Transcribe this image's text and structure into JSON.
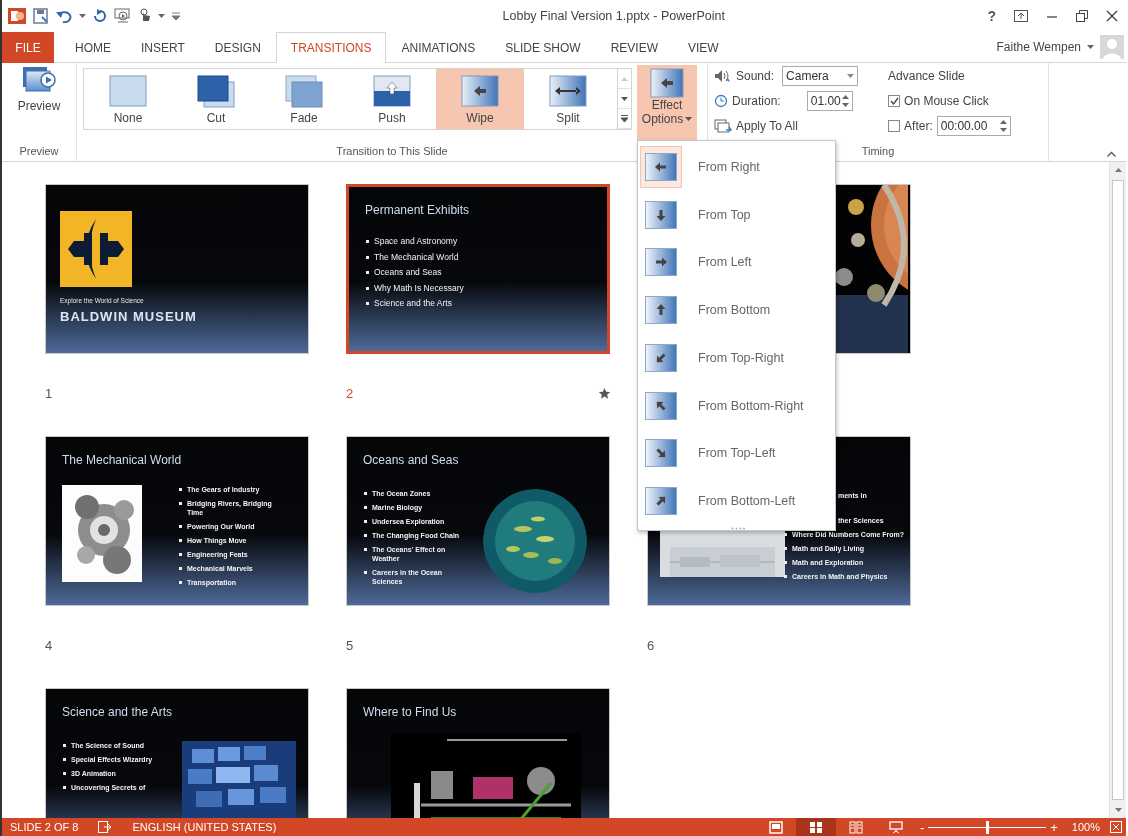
{
  "window": {
    "title": "Lobby Final Version 1.pptx - PowerPoint",
    "help": "?"
  },
  "tabs": [
    {
      "label": "FILE",
      "kind": "file",
      "selected": false
    },
    {
      "label": "HOME",
      "kind": "tab",
      "selected": false
    },
    {
      "label": "INSERT",
      "kind": "tab",
      "selected": false
    },
    {
      "label": "DESIGN",
      "kind": "tab",
      "selected": false
    },
    {
      "label": "TRANSITIONS",
      "kind": "tab",
      "selected": true
    },
    {
      "label": "ANIMATIONS",
      "kind": "tab",
      "selected": false
    },
    {
      "label": "SLIDE SHOW",
      "kind": "tab",
      "selected": false
    },
    {
      "label": "REVIEW",
      "kind": "tab",
      "selected": false
    },
    {
      "label": "VIEW",
      "kind": "tab",
      "selected": false
    }
  ],
  "user": {
    "name": "Faithe Wempen"
  },
  "ribbon": {
    "preview": {
      "button": "Preview",
      "group": "Preview"
    },
    "gallery": {
      "group": "Transition to This Slide",
      "items": [
        {
          "label": "None",
          "kind": "none",
          "selected": false
        },
        {
          "label": "Cut",
          "kind": "cut",
          "selected": false
        },
        {
          "label": "Fade",
          "kind": "fade",
          "selected": false
        },
        {
          "label": "Push",
          "kind": "push",
          "selected": false
        },
        {
          "label": "Wipe",
          "kind": "wipe",
          "selected": true
        },
        {
          "label": "Split",
          "kind": "split",
          "selected": false
        }
      ]
    },
    "effect_options": {
      "line1": "Effect",
      "line2": "Options",
      "expanded": true
    },
    "timing": {
      "group": "Timing",
      "sound": {
        "label": "Sound:",
        "value": "Camera"
      },
      "duration": {
        "label": "Duration:",
        "value": "01.00"
      },
      "apply_all": "Apply To All",
      "advance": {
        "title": "Advance Slide",
        "on_mouse_click": {
          "label": "On Mouse Click",
          "checked": true
        },
        "after": {
          "label": "After:",
          "checked": false,
          "value": "00:00.00"
        }
      }
    }
  },
  "slides": [
    {
      "kind": "title",
      "number": "1",
      "selected": false,
      "transition": false,
      "tagline": "Explore the World of Science",
      "title": "BALDWIN MUSEUM"
    },
    {
      "kind": "bullets",
      "number": "2",
      "selected": true,
      "transition": true,
      "title": "Permanent Exhibits",
      "bullets": [
        "Space and Astronomy",
        "The Mechanical World",
        "Oceans and Seas",
        "Why Math Is Necessary",
        "Science and the Arts"
      ]
    },
    {
      "kind": "picture"
    },
    {
      "kind": "picture-left",
      "number": "4",
      "selected": false,
      "transition": false,
      "title": "The Mechanical World",
      "bullets": [
        "The Gears of Industry",
        "Bridging Rivers, Bridging Time",
        "Powering Our World",
        "How Things Move",
        "Engineering Feats",
        "Mechanical Marvels",
        "Transportation"
      ]
    },
    {
      "kind": "picture-right",
      "number": "5",
      "selected": false,
      "transition": false,
      "title": "Oceans and Seas",
      "bullets": [
        "The Ocean Zones",
        "Marine Biology",
        "Undersea Exploration",
        "The Changing Food Chain",
        "The Oceans' Effect on Weather",
        "Careers in the Ocean Sciences"
      ]
    },
    {
      "kind": "partial",
      "number": "6",
      "selected": false,
      "transition": false,
      "fragments": [
        "ments in",
        "ther Sciences"
      ],
      "bullets": [
        "Where Did Numbers Come From?",
        "Math and Daily Living",
        "Math and Exploration",
        "Careers in Math and Physics"
      ]
    },
    {
      "kind": "picture-right",
      "selected": false,
      "title": "Science and the Arts",
      "bullets": [
        "The Science of Sound",
        "Special Effects Wizardry",
        "3D Animation",
        "Uncovering Secrets of"
      ]
    },
    {
      "kind": "map",
      "selected": false,
      "title": "Where to Find Us"
    }
  ],
  "effect_menu": {
    "items": [
      {
        "label": "From Right",
        "kind": "from-right",
        "selected": true
      },
      {
        "label": "From Top",
        "kind": "from-top",
        "selected": false
      },
      {
        "label": "From Left",
        "kind": "from-left",
        "selected": false
      },
      {
        "label": "From Bottom",
        "kind": "from-bottom",
        "selected": false
      },
      {
        "label": "From Top-Right",
        "kind": "from-top-right",
        "selected": false
      },
      {
        "label": "From Bottom-Right",
        "kind": "from-bottom-right",
        "selected": false
      },
      {
        "label": "From Top-Left",
        "kind": "from-top-left",
        "selected": false
      },
      {
        "label": "From Bottom-Left",
        "kind": "from-bottom-left",
        "selected": false
      }
    ]
  },
  "status_bar": {
    "slide": "SLIDE 2 OF 8",
    "language": "ENGLISH (UNITED STATES)",
    "views": [
      {
        "kind": "normal",
        "selected": false
      },
      {
        "kind": "sorter",
        "selected": true
      },
      {
        "kind": "reading",
        "selected": false
      },
      {
        "kind": "show",
        "selected": false
      }
    ],
    "zoom_out": "-",
    "zoom_in": "+",
    "zoom": {
      "level": 0.5
    },
    "zoom_text": "100%"
  }
}
